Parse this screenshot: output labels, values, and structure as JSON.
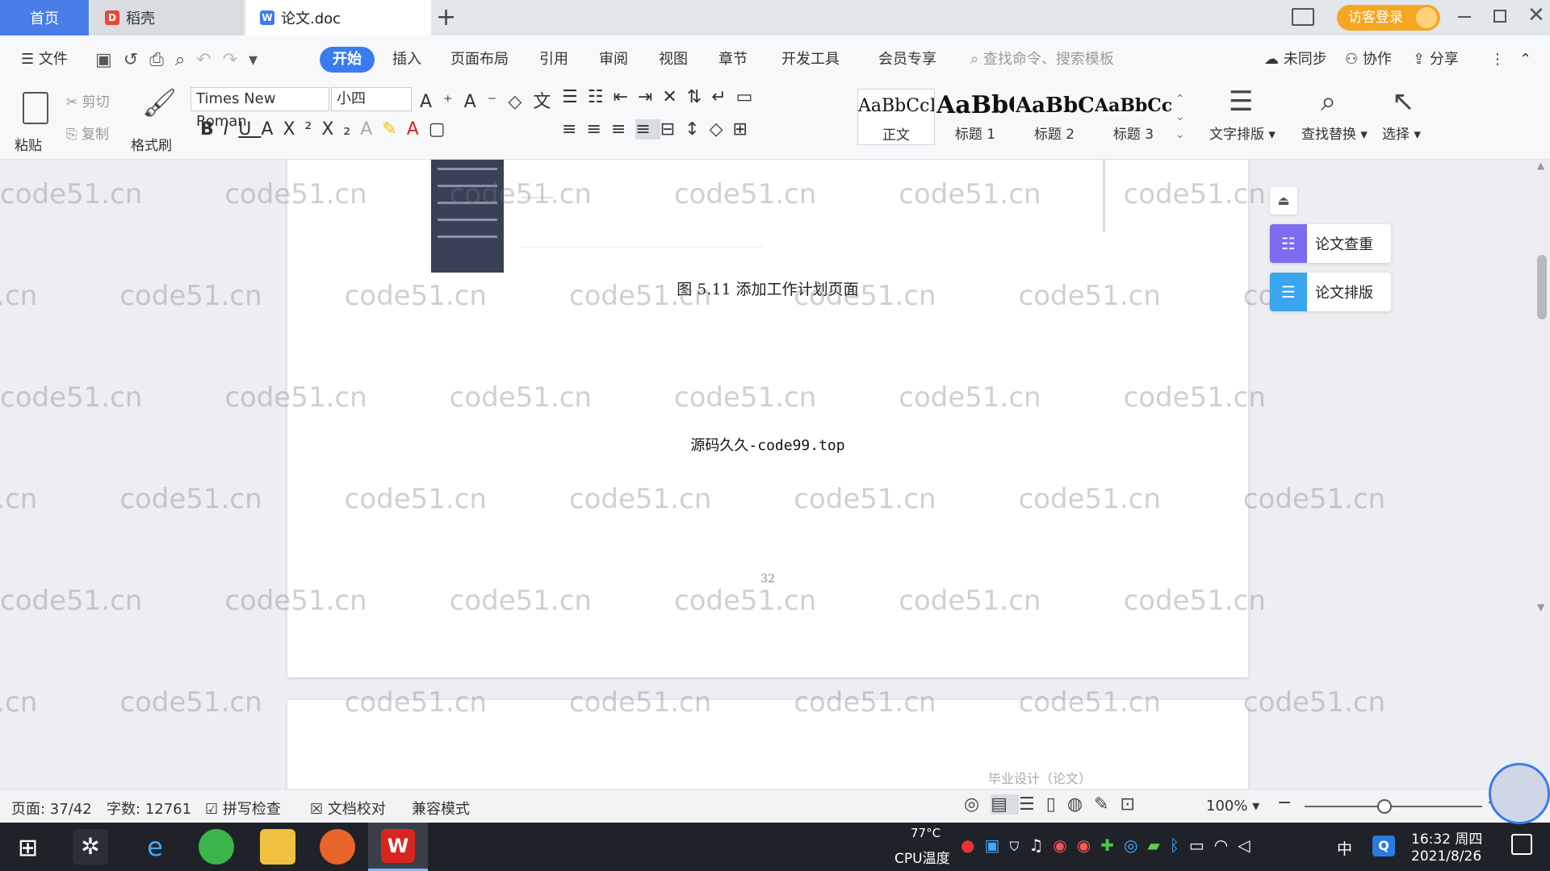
{
  "tabs": {
    "home": "首页",
    "docer": "稻壳",
    "doc": "论文.doc",
    "add": "+"
  },
  "titlebar": {
    "login": "访客登录"
  },
  "menu": {
    "file": "文件",
    "items": [
      "开始",
      "插入",
      "页面布局",
      "引用",
      "审阅",
      "视图",
      "章节",
      "开发工具",
      "会员专享"
    ],
    "search": "查找命令、搜索模板",
    "unsynced": "未同步",
    "collab": "协作",
    "share": "分享"
  },
  "ribbon": {
    "paste": "粘贴",
    "cut": "剪切",
    "copy": "复制",
    "format_painter": "格式刷",
    "font_name": "Times New Roman",
    "font_size": "小四",
    "styles": [
      {
        "preview": "AaBbCcDd",
        "label": "正文"
      },
      {
        "preview": "AaBbC",
        "label": "标题 1"
      },
      {
        "preview": "AaBbC",
        "label": "标题 2"
      },
      {
        "preview": "AaBbCcD",
        "label": "标题 3"
      }
    ],
    "text_layout": "文字排版",
    "find_replace": "查找替换",
    "select": "选择"
  },
  "document": {
    "figure_caption": "图 5.11  添加工作计划页面",
    "source_line": "源码久久-code99.top",
    "page_number": "32",
    "next_header": "毕业设计（论文）",
    "watermark": "code51.cn"
  },
  "side_panel": {
    "check": "论文查重",
    "layout": "论文排版"
  },
  "status": {
    "page": "页面: 37/42",
    "words": "字数: 12761",
    "spell": "拼写检查",
    "proof": "文档校对",
    "compat": "兼容模式",
    "zoom": "100%"
  },
  "taskbar": {
    "temp": "77°C",
    "temp_label": "CPU温度",
    "ime": "中",
    "time": "16:32 周四",
    "date": "2021/8/26"
  },
  "colors": {
    "accent": "#3a7cf0",
    "home_tab": "#4a7de8",
    "login": "#f5a623"
  }
}
